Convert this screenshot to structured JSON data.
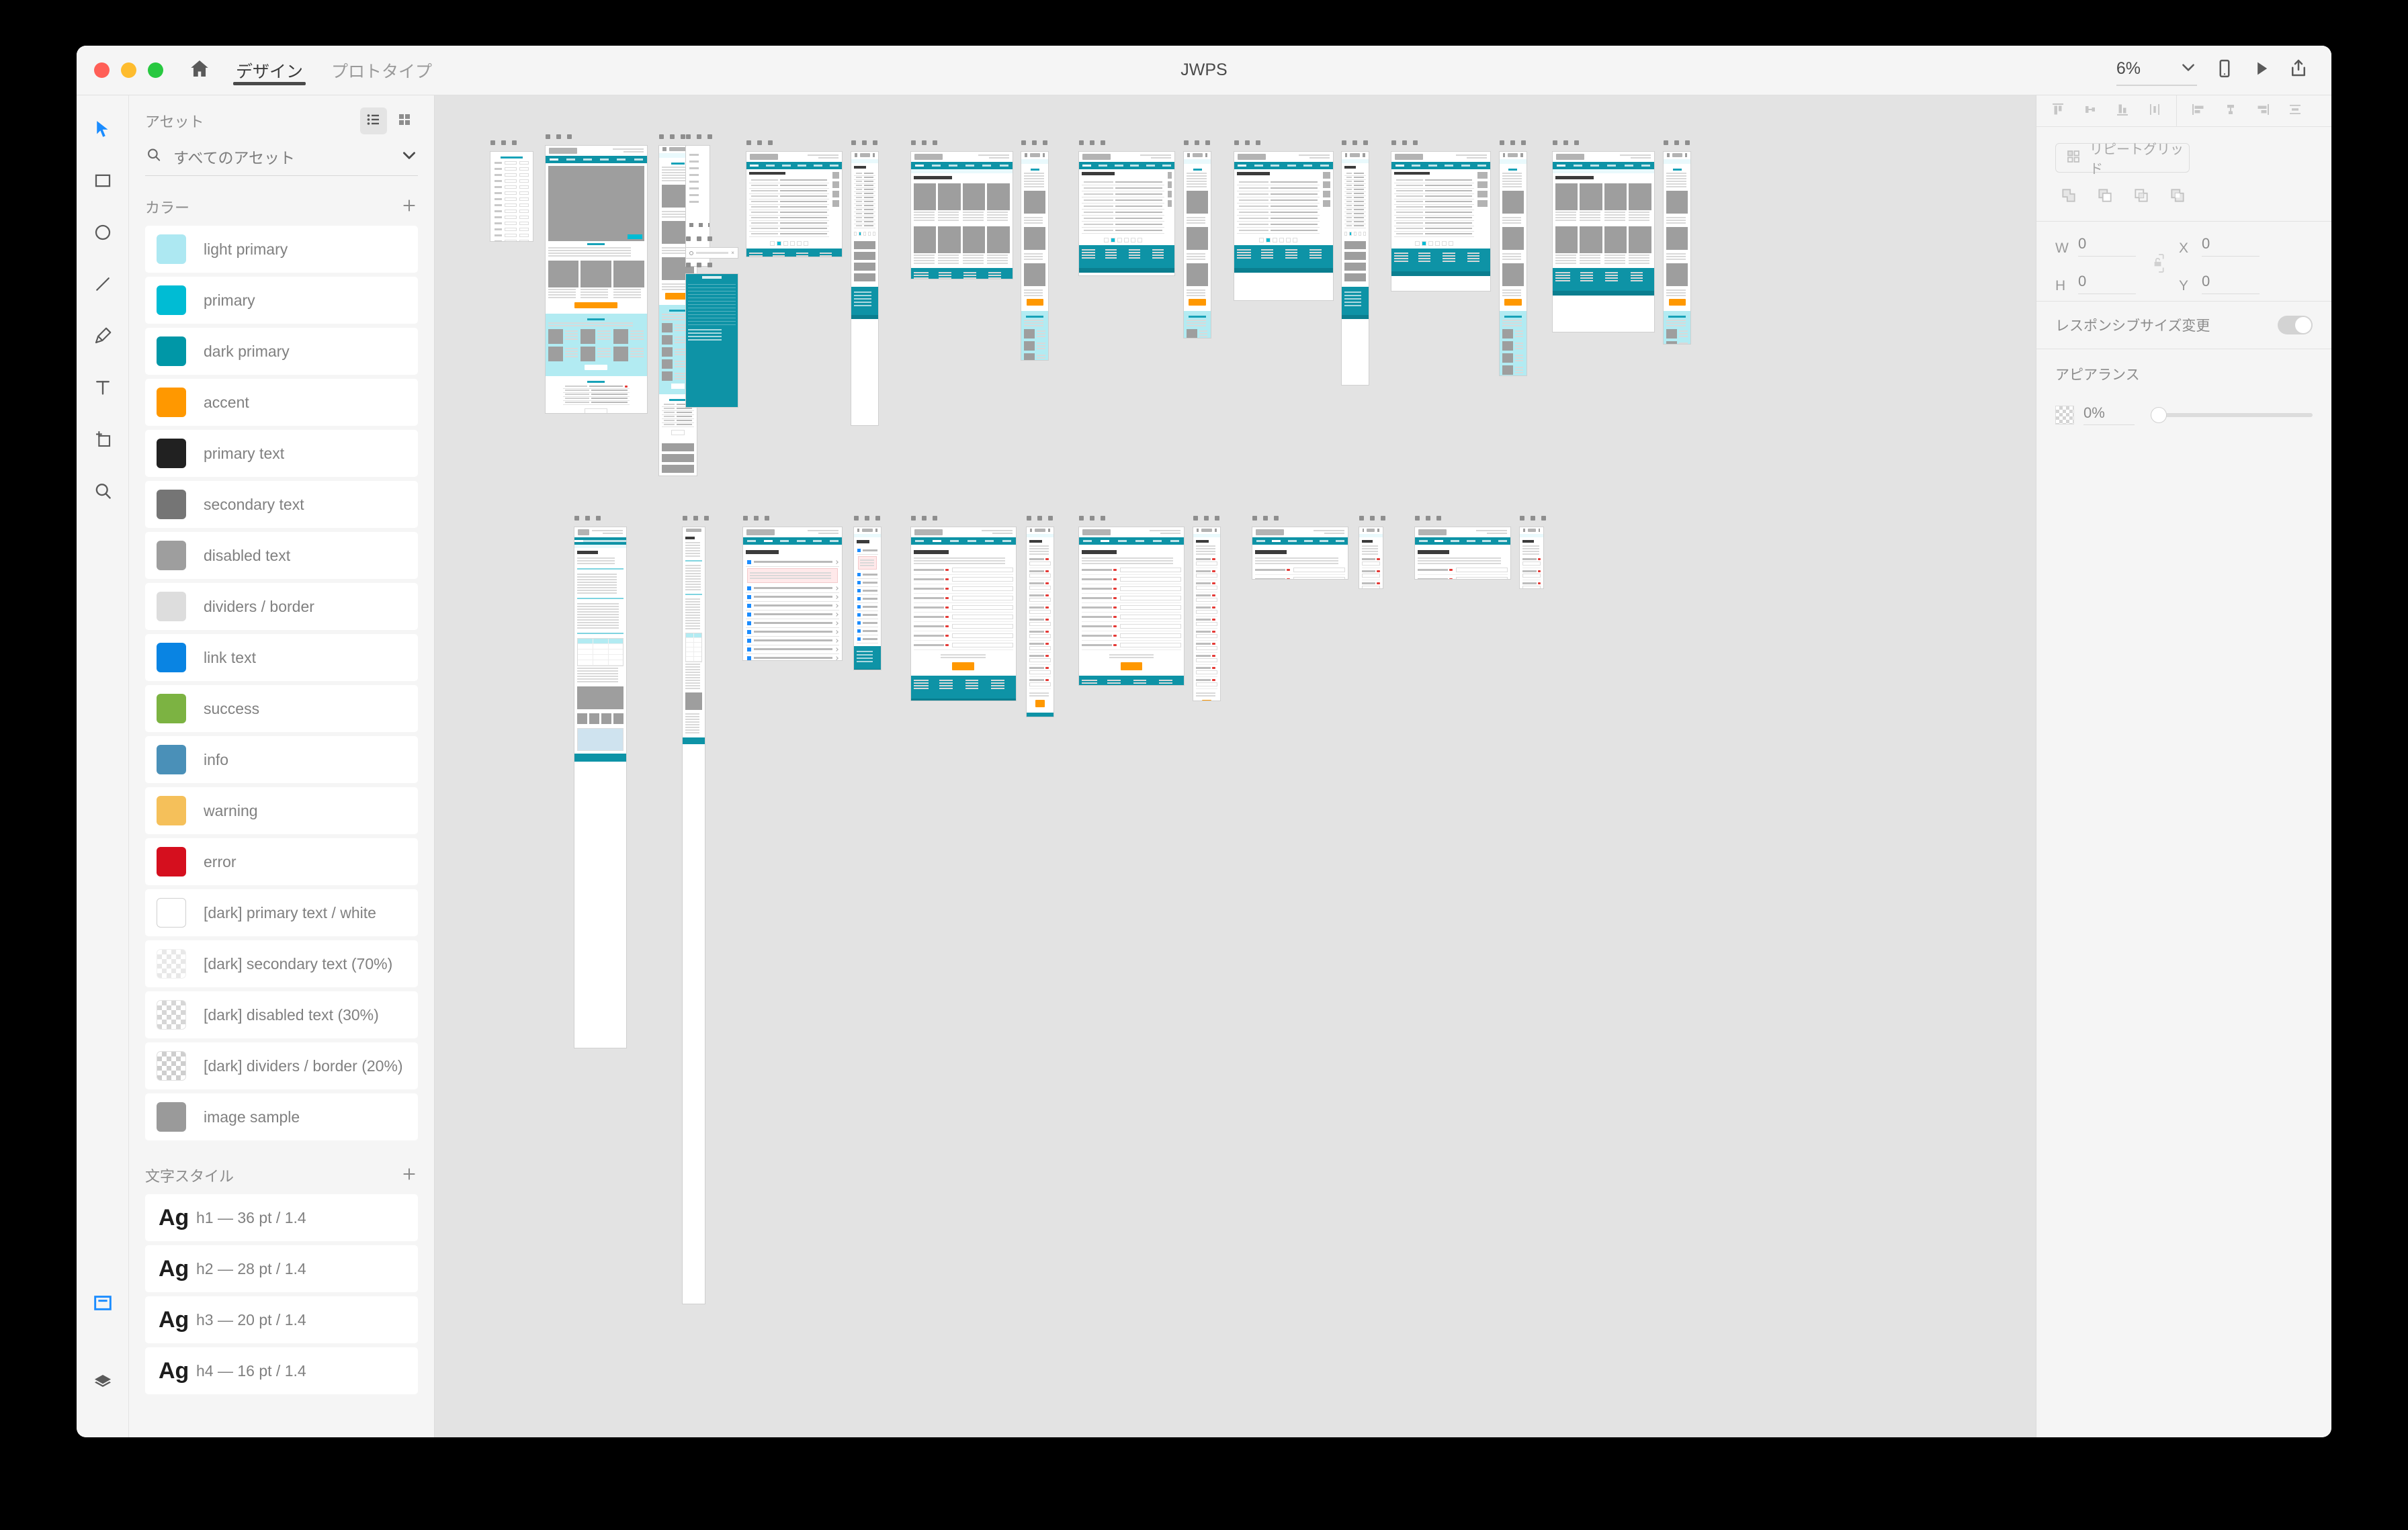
{
  "window": {
    "title": "JWPS",
    "traffic_lights": [
      "close",
      "minimize",
      "maximize"
    ]
  },
  "tabs": [
    {
      "label": "デザイン",
      "active": true
    },
    {
      "label": "プロトタイプ",
      "active": false
    }
  ],
  "toolbar_right": {
    "zoom_value": "6%",
    "icons": [
      "chevron-down-icon",
      "device-preview-icon",
      "play-icon",
      "share-icon"
    ]
  },
  "tools": [
    {
      "name": "select-tool",
      "active": true
    },
    {
      "name": "rectangle-tool",
      "active": false
    },
    {
      "name": "ellipse-tool",
      "active": false
    },
    {
      "name": "line-tool",
      "active": false
    },
    {
      "name": "pen-tool",
      "active": false
    },
    {
      "name": "text-tool",
      "active": false
    },
    {
      "name": "artboard-tool",
      "active": false
    },
    {
      "name": "zoom-tool",
      "active": false
    }
  ],
  "tools_bottom": [
    {
      "name": "assets-panel-tool",
      "active": true
    },
    {
      "name": "layers-panel-tool",
      "active": false
    }
  ],
  "assets": {
    "panel_title": "アセット",
    "view_list_icon": "list-view-icon",
    "view_grid_icon": "grid-view-icon",
    "search_placeholder": "すべてのアセット",
    "search_value": "すべてのアセット",
    "colors_section": "カラー",
    "colors": [
      {
        "label": "light primary",
        "hex": "#ADE8F2",
        "kind": "solid"
      },
      {
        "label": "primary",
        "hex": "#00BCD4",
        "kind": "solid"
      },
      {
        "label": "dark primary",
        "hex": "#0097A7",
        "kind": "solid"
      },
      {
        "label": "accent",
        "hex": "#FF9800",
        "kind": "solid"
      },
      {
        "label": "primary text",
        "hex": "#212121",
        "kind": "solid"
      },
      {
        "label": "secondary text",
        "hex": "#757575",
        "kind": "solid"
      },
      {
        "label": "disabled text",
        "hex": "#9E9E9E",
        "kind": "solid"
      },
      {
        "label": "dividers / border",
        "hex": "#DDDDDD",
        "kind": "solid"
      },
      {
        "label": "link text",
        "hex": "#0984E3",
        "kind": "solid"
      },
      {
        "label": "success",
        "hex": "#7CB342",
        "kind": "solid"
      },
      {
        "label": "info",
        "hex": "#4A90B8",
        "kind": "solid"
      },
      {
        "label": "warning",
        "hex": "#F5C05A",
        "kind": "solid"
      },
      {
        "label": "error",
        "hex": "#D50F1E",
        "kind": "solid"
      },
      {
        "label": "[dark] primary text / white",
        "hex": "#FFFFFF",
        "kind": "white"
      },
      {
        "label": "[dark] secondary text (70%)",
        "hex": "#FFFFFF",
        "kind": "checker70"
      },
      {
        "label": "[dark] disabled text (30%)",
        "hex": "#FFFFFF",
        "kind": "checker30"
      },
      {
        "label": "[dark] dividers / border (20%)",
        "hex": "#FFFFFF",
        "kind": "checker20"
      },
      {
        "label": "image sample",
        "hex": "#9A9A9A",
        "kind": "solid"
      }
    ],
    "text_styles_section": "文字スタイル",
    "text_styles": [
      {
        "glyph": "Ag",
        "label": "h1 — 36 pt / 1.4"
      },
      {
        "glyph": "Ag",
        "label": "h2 — 28 pt / 1.4"
      },
      {
        "glyph": "Ag",
        "label": "h3 — 20 pt / 1.4"
      },
      {
        "glyph": "Ag",
        "label": "h4 — 16 pt / 1.4"
      }
    ]
  },
  "inspector": {
    "align_vertical": [
      "align-top-icon",
      "align-middle-icon",
      "align-bottom-icon",
      "distribute-vertical-icon"
    ],
    "align_horizontal": [
      "align-left-icon",
      "align-center-icon",
      "align-right-icon",
      "distribute-horizontal-icon"
    ],
    "repeat_grid_label": "リピートグリッド",
    "boolean_ops": [
      "add-icon",
      "subtract-icon",
      "intersect-icon",
      "exclude-icon"
    ],
    "dims": {
      "w_label": "W",
      "w_value": "0",
      "h_label": "H",
      "h_value": "0",
      "x_label": "X",
      "x_value": "0",
      "y_label": "Y",
      "y_value": "0",
      "lock_icon": "unlocked-icon"
    },
    "responsive_resize_label": "レスポンシブサイズ変更",
    "responsive_resize_on": false,
    "appearance_label": "アピアランス",
    "opacity_value": "0%"
  },
  "canvas": {
    "zoom_percent": 6,
    "background": "#E3E3E3",
    "artboard_label_placeholder": "...",
    "palette": {
      "nav_teal": "#0E93A6",
      "nav_selected": "#4ECBE0",
      "light_primary": "#B2EBF2",
      "accent": "#FF9800",
      "placeholder_gray": "#9E9E9E",
      "footer_teal": "#0E93A6"
    },
    "rows": [
      {
        "name": "row-1",
        "artboards": [
          {
            "name": "sitemap-board",
            "kind": "list-board"
          },
          {
            "name": "home-desktop",
            "kind": "home-desktop"
          },
          {
            "name": "home-mobile",
            "kind": "home-mobile"
          },
          {
            "name": "menu-mobile",
            "kind": "menu-mobile"
          },
          {
            "name": "news-list-desktop",
            "kind": "list-desktop"
          },
          {
            "name": "news-list-mobile",
            "kind": "list-mobile"
          },
          {
            "name": "news-detail-desktop",
            "kind": "detail-desktop"
          },
          {
            "name": "news-detail-mobile",
            "kind": "detail-mobile"
          },
          {
            "name": "card-list-desktop",
            "kind": "card-desktop"
          },
          {
            "name": "card-list-mobile",
            "kind": "card-mobile"
          },
          {
            "name": "search-desktop",
            "kind": "search-desktop"
          },
          {
            "name": "search-mobile",
            "kind": "search-mobile"
          },
          {
            "name": "archive-desktop",
            "kind": "archive-desktop"
          },
          {
            "name": "archive-mobile",
            "kind": "archive-mobile"
          },
          {
            "name": "index-desktop",
            "kind": "index-desktop"
          },
          {
            "name": "index-mobile",
            "kind": "index-mobile"
          },
          {
            "name": "styleguide-desktop",
            "kind": "styleguide-desktop"
          },
          {
            "name": "styleguide-mobile",
            "kind": "styleguide-mobile"
          }
        ]
      },
      {
        "name": "row-2",
        "artboards": [
          {
            "name": "components-desktop",
            "kind": "components-desktop"
          },
          {
            "name": "components-mobile",
            "kind": "components-mobile"
          },
          {
            "name": "faq-desktop",
            "kind": "faq-desktop"
          },
          {
            "name": "faq-mobile",
            "kind": "faq-mobile"
          },
          {
            "name": "form-desktop",
            "kind": "form-desktop"
          },
          {
            "name": "form-mobile",
            "kind": "form-mobile"
          },
          {
            "name": "confirm-desktop",
            "kind": "confirm-desktop"
          },
          {
            "name": "confirm-mobile",
            "kind": "confirm-mobile"
          },
          {
            "name": "complete-desktop",
            "kind": "complete-desktop"
          },
          {
            "name": "complete-mobile",
            "kind": "complete-mobile"
          },
          {
            "name": "error-desktop",
            "kind": "error-desktop"
          },
          {
            "name": "error-mobile",
            "kind": "error-mobile"
          }
        ]
      }
    ]
  }
}
